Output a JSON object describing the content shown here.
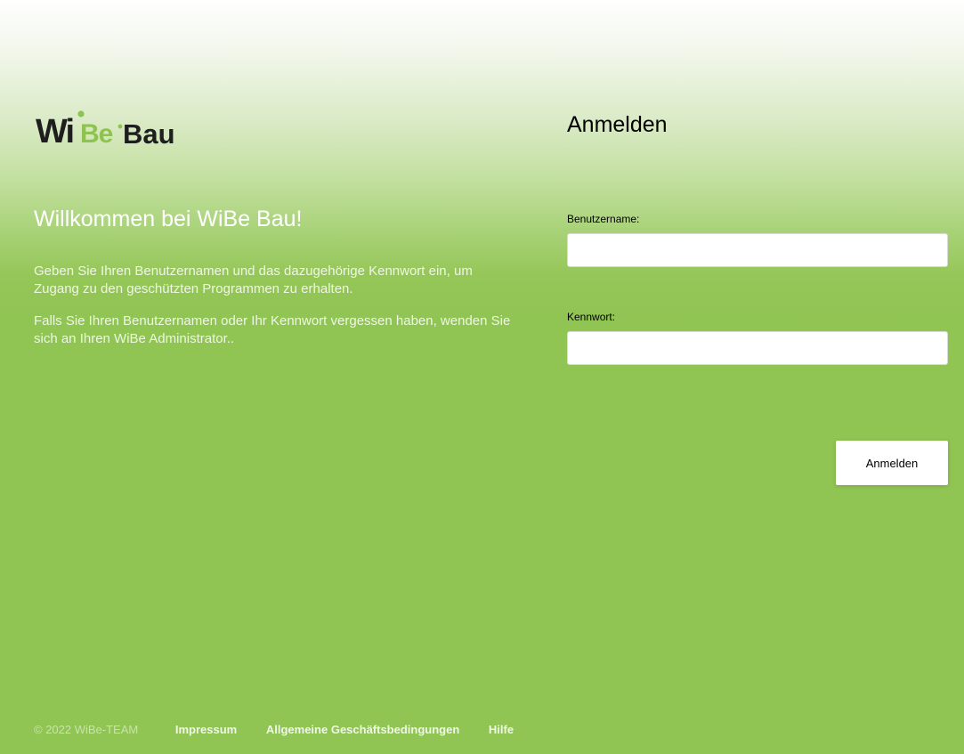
{
  "logo": {
    "brand_wi": "Wi",
    "brand_be": "Be",
    "brand_bau": "Bau",
    "colors": {
      "dark": "#1e1e1e",
      "green": "#8fc350"
    }
  },
  "welcome": {
    "title": "Willkommen bei WiBe Bau!",
    "paragraph_1": "Geben Sie Ihren Benutzernamen und das dazugehörige Kennwort ein, um Zugang zu den geschützten Programmen zu erhalten.",
    "paragraph_2": "Falls Sie Ihren Benutzernamen oder Ihr Kennwort vergessen haben, wenden Sie sich an Ihren WiBe Administrator.."
  },
  "login": {
    "title": "Anmelden",
    "username_label": "Benutzername:",
    "username_value": "",
    "password_label": "Kennwort:",
    "password_value": "",
    "submit_label": "Anmelden"
  },
  "footer": {
    "copyright": "© 2022 WiBe-TEAM",
    "links": [
      "Impressum",
      "Allgemeine Geschäftsbedingungen",
      "Hilfe"
    ]
  },
  "colors": {
    "background_green": "#90c453",
    "background_top": "#ffffff",
    "text_light": "#ffffff"
  }
}
